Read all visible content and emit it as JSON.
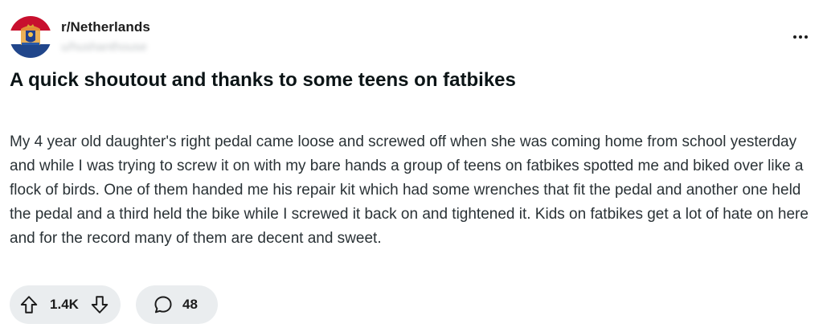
{
  "post": {
    "subreddit": "r/Netherlands",
    "username": "u/hushanthouse",
    "title": "A quick shoutout and thanks to some teens on fatbikes",
    "body": "My 4 year old daughter's right pedal came loose and screwed off when she was coming home from school yesterday and while I was trying to screw it on with my bare hands a group of teens on fatbikes spotted me and biked over like a flock of birds. One of them handed me his repair kit which had some wrenches that fit the pedal and another one held the pedal and a third held the bike while I screwed it back on and tightened it. Kids on fatbikes get a lot of hate on here and for the record many of them are decent and sweet.",
    "avatar_icon": "netherlands-flag-coat-of-arms",
    "more_icon": "more-horizontal-icon"
  },
  "actions": {
    "upvote_icon": "upvote-arrow-icon",
    "vote_count": "1.4K",
    "downvote_icon": "downvote-arrow-icon",
    "comment_icon": "comment-bubble-icon",
    "comment_count": "48"
  },
  "colors": {
    "flag_red": "#c8102e",
    "flag_white": "#ffffff",
    "flag_blue": "#21468b",
    "pill_background": "#eaedef"
  }
}
